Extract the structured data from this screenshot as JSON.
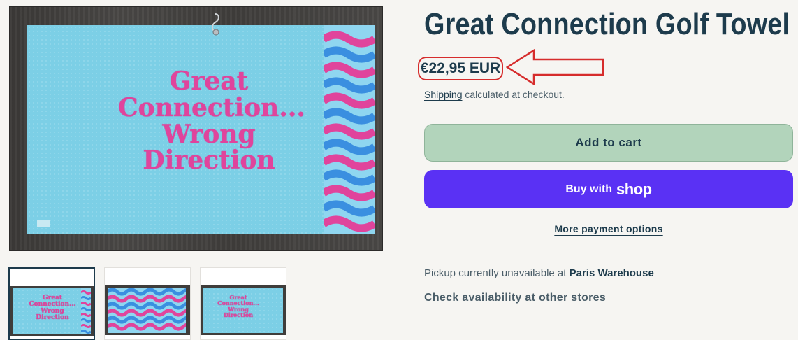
{
  "product": {
    "title": "Great Connection Golf Towel",
    "price": "€22,95 EUR",
    "shipping_link": "Shipping",
    "shipping_suffix": " calculated at checkout.",
    "towel_text": [
      "Great",
      "Connection...",
      "Wrong",
      "Direction"
    ]
  },
  "buttons": {
    "add_to_cart": "Add to cart",
    "buy_with_prefix": "Buy with",
    "shop_wordmark": "shop",
    "more_payment_options": "More payment options"
  },
  "pickup": {
    "prefix": "Pickup currently unavailable at ",
    "store": "Paris Warehouse",
    "check_availability": "Check availability at other stores"
  },
  "colors": {
    "title": "#1d3b4c",
    "add_to_cart_bg": "#b2d4bb",
    "shop_pay_bg": "#5a31f4",
    "annotation_red": "#d62c2c",
    "towel_blue": "#7ccfe6",
    "towel_pink": "#e0449c"
  },
  "media": {
    "thumbnails": [
      {
        "name": "towel-front",
        "selected": true
      },
      {
        "name": "towel-pattern",
        "selected": false
      },
      {
        "name": "towel-full",
        "selected": false
      }
    ]
  }
}
